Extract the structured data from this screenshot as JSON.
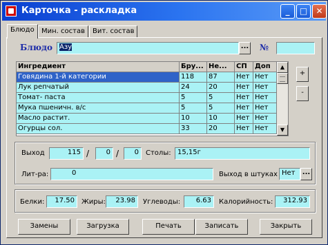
{
  "window": {
    "title": "Карточка - раскладка"
  },
  "tabs": [
    {
      "label": "Блюдо"
    },
    {
      "label": "Мин. состав"
    },
    {
      "label": "Вит. состав"
    }
  ],
  "dish": {
    "label": "Блюдо",
    "value": "Азу",
    "number_label": "№",
    "number_value": ""
  },
  "table": {
    "headers": [
      "Ингредиент",
      "Бру...",
      "Не...",
      "СП",
      "Доп"
    ],
    "rows": [
      [
        "Говядина 1-й категории",
        "118",
        "87",
        "Нет",
        "Нет"
      ],
      [
        "Лук репчатый",
        "24",
        "20",
        "Нет",
        "Нет"
      ],
      [
        "Томат- паста",
        "5",
        "5",
        "Нет",
        "Нет"
      ],
      [
        "Мука пшеничн. в/с",
        "5",
        "5",
        "Нет",
        "Нет"
      ],
      [
        "Масло растит.",
        "10",
        "10",
        "Нет",
        "Нет"
      ],
      [
        "Огурцы сол.",
        "33",
        "20",
        "Нет",
        "Нет"
      ]
    ]
  },
  "side_buttons": {
    "add": "+",
    "remove": "-"
  },
  "output": {
    "label": "Выход",
    "v1": "115",
    "sep1": "/",
    "v2": "0",
    "sep2": "/",
    "v3": "0",
    "stoly_label": "Столы:",
    "stoly_value": "15,15г",
    "litra_label": "Лит-ра:",
    "litra_value": "0",
    "pieces_label": "Выход в штуках",
    "pieces_value": "Нет"
  },
  "nutrition": {
    "protein_label": "Белки:",
    "protein_value": "17.50",
    "fat_label": "Жиры:",
    "fat_value": "23.98",
    "carbs_label": "Углеводы:",
    "carbs_value": "6.63",
    "kcal_label": "Калорийность:",
    "kcal_value": "312.93"
  },
  "buttons": {
    "replace": "Замены",
    "load": "Загрузка",
    "print": "Печать",
    "save": "Записать",
    "close": "Закрыть"
  },
  "colors": {
    "field_bg": "#aaf2f5",
    "selected_row": "#2f63c8",
    "titlebar": "#0a3fd0"
  }
}
